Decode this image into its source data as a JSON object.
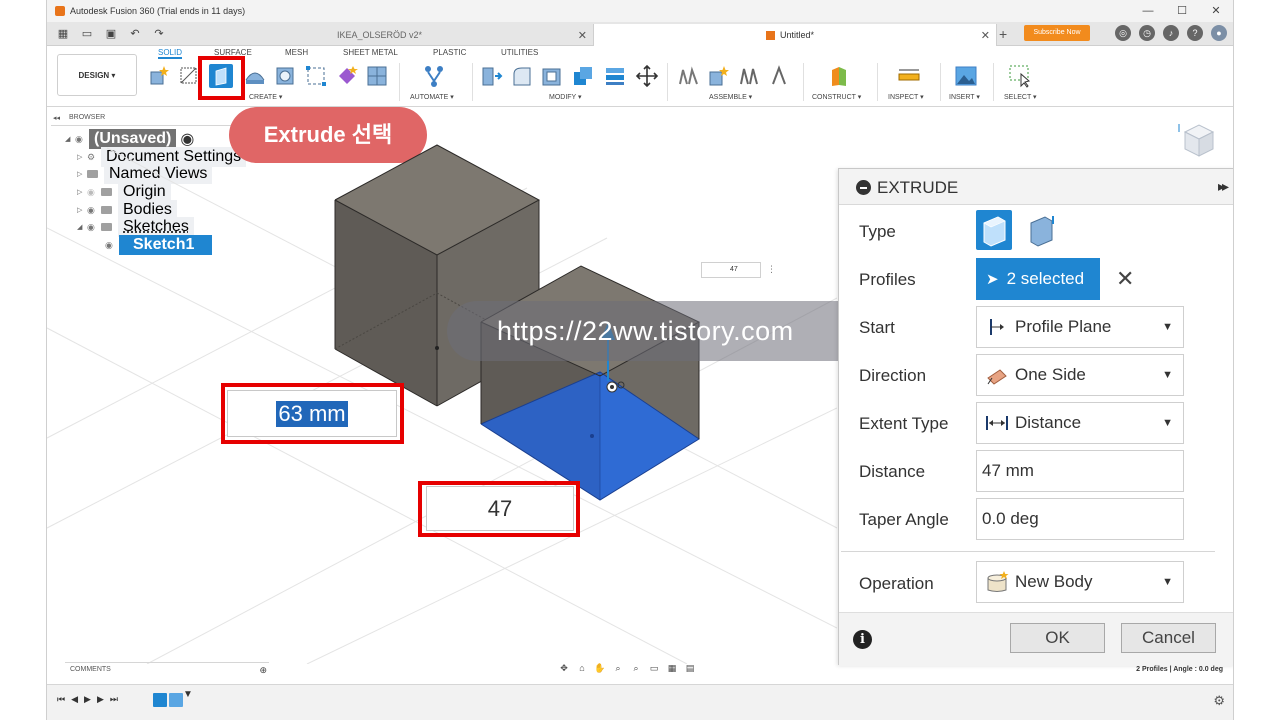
{
  "app": {
    "window_title": "Autodesk Fusion 360 (Trial ends in 11 days)",
    "window_controls": {
      "minimize": "—",
      "maximize": "☐",
      "close": "✕"
    }
  },
  "tabs": {
    "doc1": "IKEA_OLSERÖD v2*",
    "doc2": "Untitled*",
    "new_tab": "+",
    "subscribe": "Subscribe Now"
  },
  "ribbon": {
    "workspace": "DESIGN ▾",
    "tabs": [
      "SOLID",
      "SURFACE",
      "MESH",
      "SHEET METAL",
      "PLASTIC",
      "UTILITIES"
    ],
    "groups": {
      "create": "CREATE ▾",
      "automate": "AUTOMATE ▾",
      "modify": "MODIFY ▾",
      "assemble": "ASSEMBLE ▾",
      "construct": "CONSTRUCT ▾",
      "inspect": "INSPECT ▾",
      "insert": "INSERT ▾",
      "select": "SELECT ▾"
    }
  },
  "browser": {
    "header": "BROWSER",
    "items": {
      "root": "(Unsaved)",
      "doc_settings": "Document Settings",
      "named_views": "Named Views",
      "origin": "Origin",
      "bodies": "Bodies",
      "sketches": "Sketches",
      "sketch1": "Sketch1"
    }
  },
  "callout": "Extrude 선택",
  "viewport": {
    "dim_63": "63 mm",
    "dim_47": "47",
    "mini_input": "47",
    "mini_menu": "⋮",
    "watermark": "https://22ww.tistory.com"
  },
  "extrude_panel": {
    "title": "EXTRUDE",
    "expand": "▸▸",
    "labels": {
      "type": "Type",
      "profiles": "Profiles",
      "start": "Start",
      "direction": "Direction",
      "extent_type": "Extent Type",
      "distance": "Distance",
      "taper_angle": "Taper Angle",
      "operation": "Operation"
    },
    "profiles_value": "2 selected",
    "clear": "✕",
    "start_value": "Profile Plane",
    "direction_value": "One Side",
    "extent_value": "Distance",
    "distance_value": "47 mm",
    "taper_value": "0.0 deg",
    "operation_value": "New Body",
    "caret": "▼",
    "ok": "OK",
    "cancel": "Cancel",
    "info": "i"
  },
  "bottom": {
    "comments": "COMMENTS",
    "comments_add": "⊕",
    "status": "2 Profiles | Angle : 0.0 deg",
    "settings": "⚙"
  },
  "colors": {
    "accent_blue": "#1f86d1",
    "highlight_red": "#e60000",
    "callout_red": "#e06666",
    "subscribe_orange": "#f28b1d",
    "body_gray": "#6e6a64",
    "profile_blue": "#2f6bd4"
  }
}
